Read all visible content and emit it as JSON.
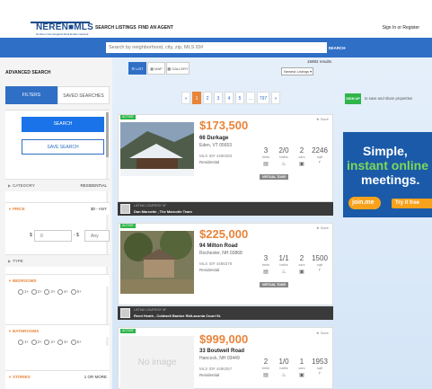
{
  "header": {
    "logo_text": "NEREN■MLS",
    "logo_sub": "Northern New England Real Estate Network",
    "nav": [
      "SEARCH LISTINGS",
      "FIND AN AGENT"
    ],
    "sign_in": "Sign In or Register"
  },
  "search": {
    "placeholder": "Search by neighborhood, city, zip, MLS ID#",
    "button": "SEARCH"
  },
  "sidebar": {
    "title": "ADVANCED SEARCH",
    "tabs": [
      "FILTERS",
      "SAVED SEARCHES"
    ],
    "search_button": "SEARCH",
    "save_search_button": "SAVE SEARCH",
    "filters": [
      {
        "label": "CATEGORY",
        "value": "RESIDENTIAL",
        "active": false
      },
      {
        "label": "PRICE",
        "value": "$0 - ANY",
        "active": true
      },
      {
        "label": "TYPE",
        "value": "",
        "active": false
      },
      {
        "label": "BEDROOMS",
        "value": "",
        "active": true
      },
      {
        "label": "BATHROOMS",
        "value": "",
        "active": true
      },
      {
        "label": "STORIES",
        "value": "1 OR MORE",
        "active": true
      }
    ],
    "price_min_placeholder": "0",
    "price_max_placeholder": "Any",
    "price_dash": "- $",
    "dollar": "$",
    "bed_options": [
      "1+",
      "2+",
      "3+",
      "4+",
      "5+"
    ],
    "bath_options": [
      "1+",
      "2+",
      "3+",
      "4+",
      "5+"
    ]
  },
  "toolbar": {
    "views": [
      "LIST",
      "MAP",
      "GALLERY"
    ],
    "results": "15982 results",
    "sort": "Newest Listings"
  },
  "pagination": [
    "«",
    "1",
    "2",
    "3",
    "4",
    "5",
    "...",
    "797",
    "»"
  ],
  "listings": [
    {
      "badge": "ACTIVE",
      "save": "★ Save",
      "price": "$173,500",
      "address1": "66 Durkage",
      "address2": "Eden, VT 05653",
      "mls": "MLS ID# 4486383",
      "ptype": "Residential",
      "beds": "3",
      "baths": "2/0",
      "cars": "2",
      "sqft": "2246",
      "virtual_tour": "VIRTUAL TOUR",
      "courtesy_label": "LISTING COURTESY OF",
      "courtesy": "Dan Marcotte , The Marcotte Team"
    },
    {
      "badge": "ACTIVE",
      "save": "★ Save",
      "price": "$225,000",
      "address1": "94 Milton Road",
      "address2": "Rochester, NH 03868",
      "mls": "MLS ID# 4486378",
      "ptype": "Residential",
      "beds": "3",
      "baths": "1/1",
      "cars": "2",
      "sqft": "1500",
      "virtual_tour": "VIRTUAL TOUR",
      "courtesy_label": "LISTING COURTESY OF",
      "courtesy": "Reed Heath , Coldwell Banker Rb/Laconia Court St."
    },
    {
      "badge": "ACTIVE",
      "save": "★ Save",
      "price": "$999,000",
      "address1": "33 Boutwell Road",
      "address2": "Hancock, NH 03449",
      "mls": "MLS ID# 4486357",
      "ptype": "Residential",
      "beds": "2",
      "baths": "1/0",
      "cars": "1",
      "sqft": "1953",
      "no_image": "No image"
    }
  ],
  "stat_labels": [
    "beds",
    "baths",
    "cars",
    "sqft"
  ],
  "right": {
    "signup_button": "SIGN UP",
    "signup_text": "to save and share properties",
    "ad_line1": "Simple,",
    "ad_line2": "instant online",
    "ad_line3": "meetings.",
    "ad_logo": "join.me",
    "ad_cta": "Try it free"
  },
  "colors": {
    "accent": "#2f6fc6",
    "price": "#e8843a",
    "active": "#2fb54a"
  }
}
